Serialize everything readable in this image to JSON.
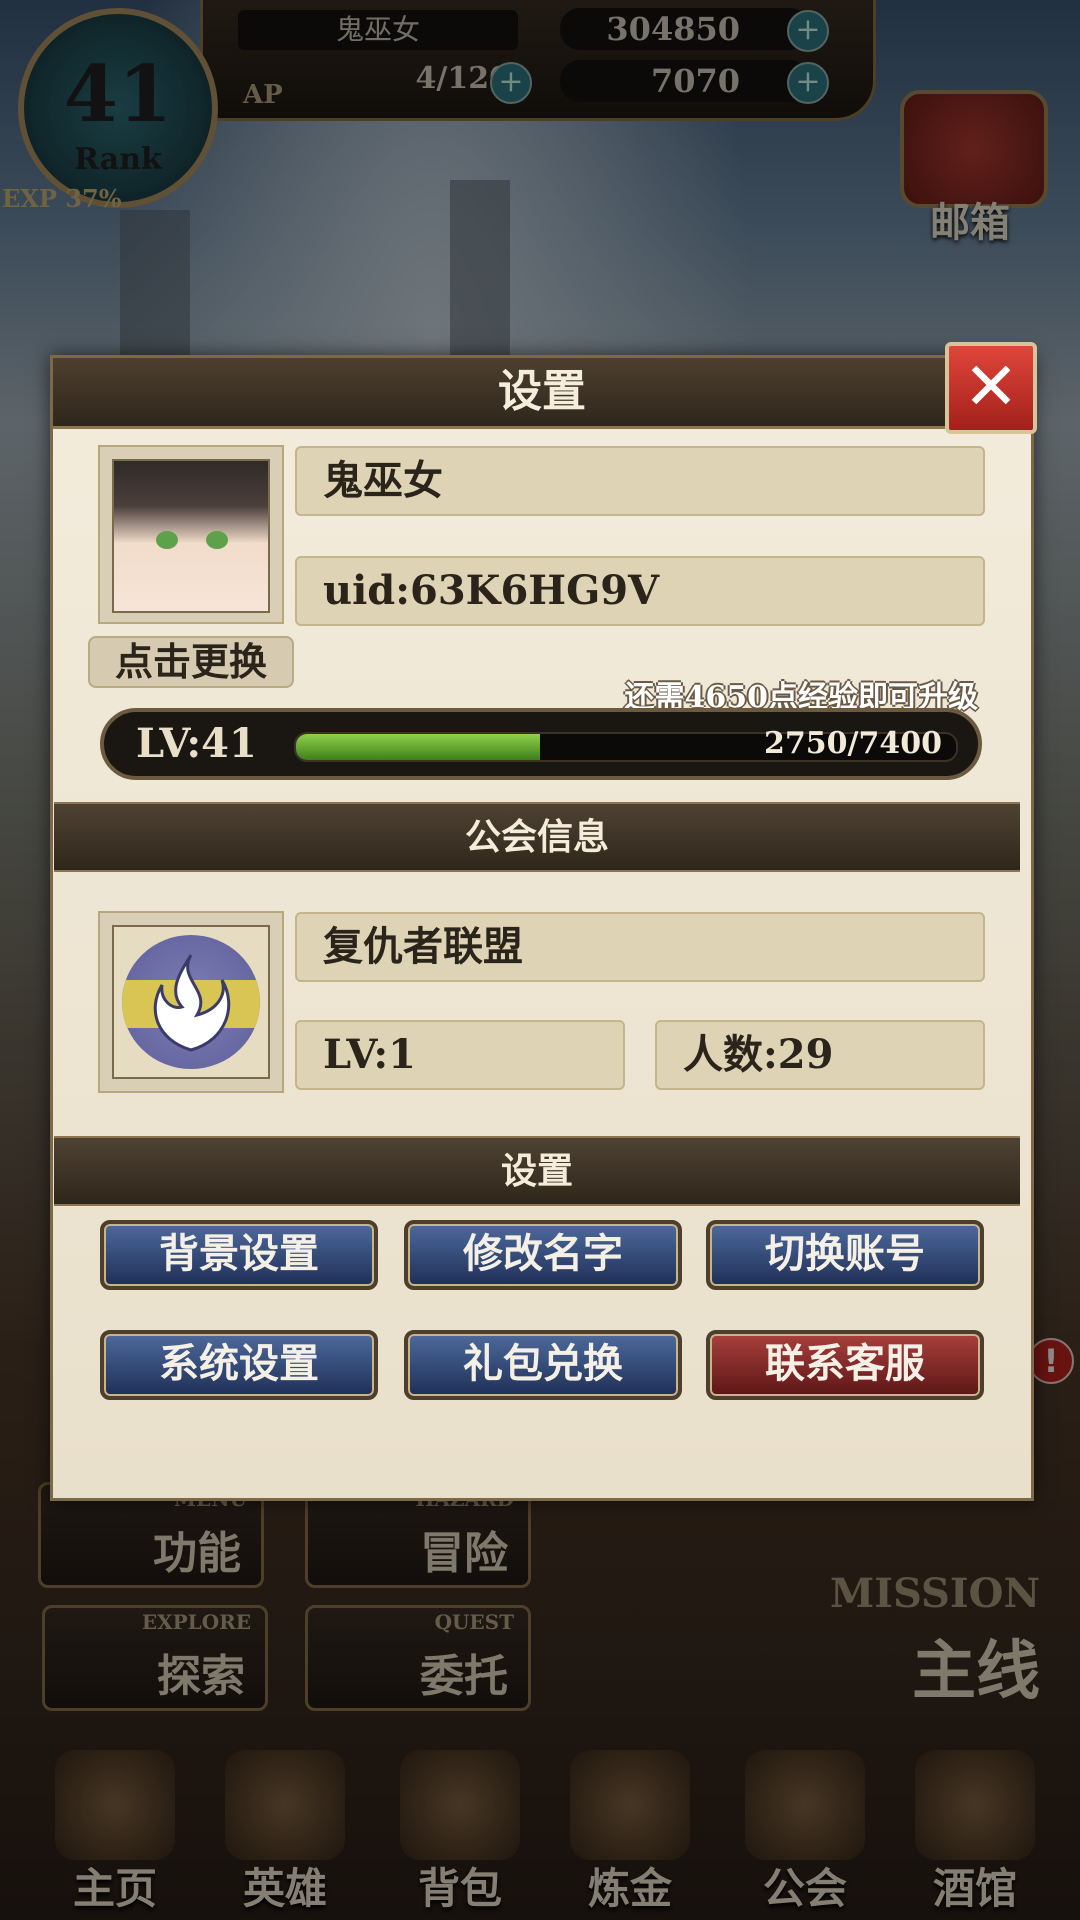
{
  "status_bar": {
    "rank_number": "41",
    "rank_label": "Rank",
    "exp_label": "EXP 37%",
    "player_name": "鬼巫女",
    "gold": "304850",
    "ap": "4/120",
    "ap_label": "AP",
    "gems": "7070",
    "plus_symbol": "+"
  },
  "side": {
    "mail_label": "邮箱"
  },
  "dialog": {
    "title": "设置",
    "close_symbol": "✕",
    "profile": {
      "name": "鬼巫女",
      "uid": "uid:63K6HG9V",
      "change_avatar_label": "点击更换",
      "exp_hint": "还需4650点经验即可升级",
      "level_text": "LV:41",
      "exp_value": "2750/7400",
      "exp_progress": 0.37
    },
    "guild_section_title": "公会信息",
    "guild": {
      "name": "复仇者联盟",
      "level_text": "LV:1",
      "members_text": "人数:29"
    },
    "settings_section_title": "设置",
    "buttons": {
      "background": "背景设置",
      "rename": "修改名字",
      "switch_account": "切换账号",
      "system": "系统设置",
      "gift": "礼包兑换",
      "support": "联系客服"
    },
    "notification_badge": "!"
  },
  "menu": {
    "function_en": "MENU",
    "function_cn": "功能",
    "hazard_en": "HAZARD",
    "hazard_cn": "冒险",
    "explore_en": "EXPLORE",
    "explore_cn": "探索",
    "quest_en": "QUEST",
    "quest_cn": "委托",
    "mission_en": "MISSION",
    "mission_cn": "主线"
  },
  "bottom_nav": [
    "主页",
    "英雄",
    "背包",
    "炼金",
    "公会",
    "酒馆"
  ],
  "colors": {
    "dialog_bg": "#f3ecdc",
    "header_brown": "#3a2f23",
    "exp_green": "#6fb233",
    "btn_blue": "#2f4676",
    "btn_red": "#8a2a26",
    "close_red": "#c8322a"
  }
}
